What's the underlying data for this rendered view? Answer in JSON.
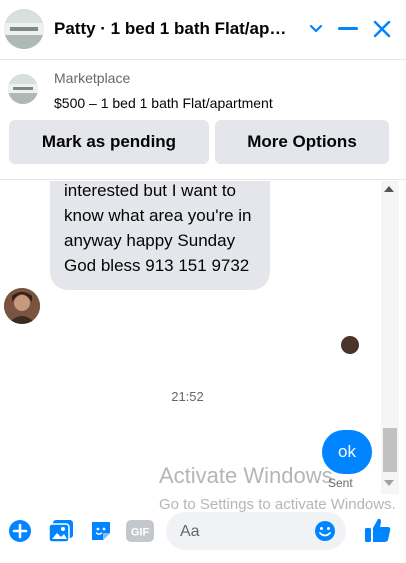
{
  "header": {
    "title": "Patty · 1 bed 1 bath Flat/ap…"
  },
  "marketplace": {
    "label": "Marketplace",
    "item": "$500 – 1 bed 1 bath Flat/apartment",
    "buttons": {
      "pending": "Mark as pending",
      "more": "More Options"
    }
  },
  "messages": {
    "incoming": "me I am very much interested but I want to know what area you're in anyway happy Sunday God bless 913 151 9732",
    "timestamp": "21:52",
    "outgoing": "ok",
    "status": "Sent"
  },
  "watermark": {
    "line1": "Activate Windows",
    "line2": "Go to Settings to activate Windows."
  },
  "composer": {
    "placeholder": "Aa",
    "gif_label": "GIF"
  },
  "colors": {
    "accent": "#0084ff",
    "bubble_in": "#e4e6eb",
    "secondary_text": "#65676b"
  }
}
